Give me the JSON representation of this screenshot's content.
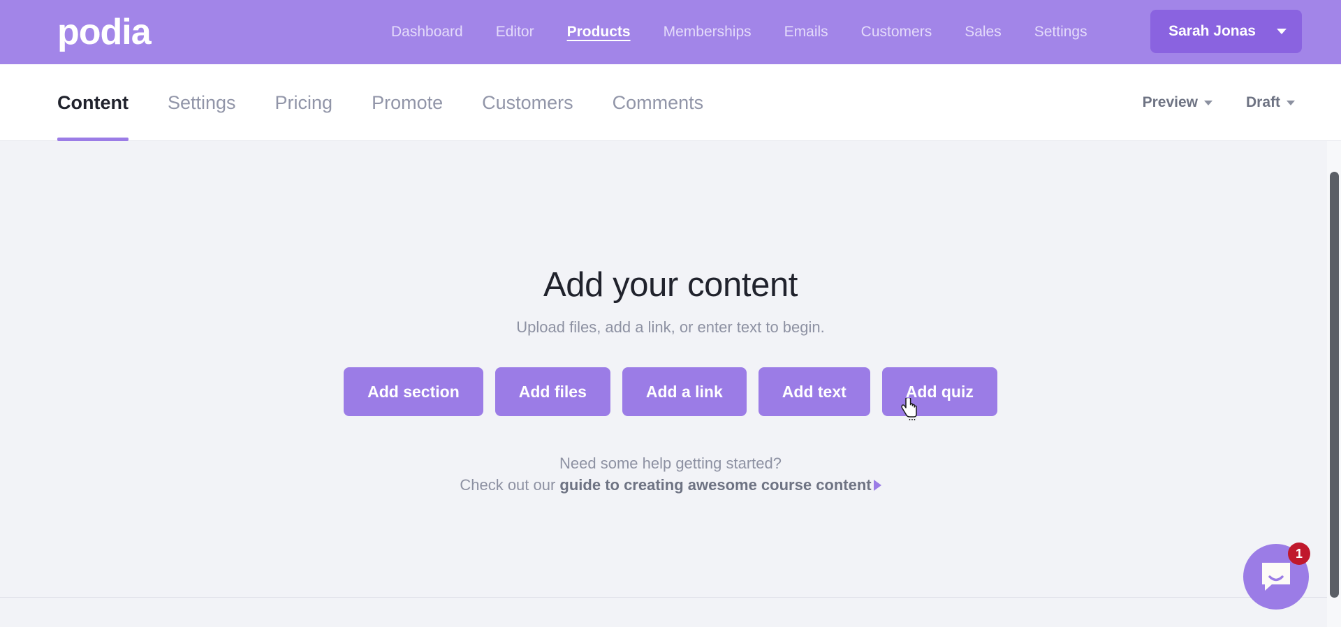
{
  "topnav": {
    "logo_text": "podia",
    "brand_color": "#a285e8",
    "links": [
      {
        "label": "Dashboard",
        "active": false
      },
      {
        "label": "Editor",
        "active": false
      },
      {
        "label": "Products",
        "active": true
      },
      {
        "label": "Memberships",
        "active": false
      },
      {
        "label": "Emails",
        "active": false
      },
      {
        "label": "Customers",
        "active": false
      },
      {
        "label": "Sales",
        "active": false
      },
      {
        "label": "Settings",
        "active": false
      }
    ],
    "account": {
      "name": "Sarah Jonas",
      "caret_icon": "chevron-down-icon",
      "bg_color": "#8a63e0"
    }
  },
  "subnav": {
    "tabs": [
      {
        "label": "Content",
        "active": true
      },
      {
        "label": "Settings",
        "active": false
      },
      {
        "label": "Pricing",
        "active": false
      },
      {
        "label": "Promote",
        "active": false
      },
      {
        "label": "Customers",
        "active": false
      },
      {
        "label": "Comments",
        "active": false
      }
    ],
    "active_underline_color": "#9b7ce6",
    "actions": [
      {
        "label": "Preview",
        "caret_icon": "chevron-down-icon"
      },
      {
        "label": "Draft",
        "caret_icon": "chevron-down-icon"
      }
    ]
  },
  "main": {
    "background_color": "#f2f3f7",
    "title": "Add your content",
    "subtitle": "Upload files, add a link, or enter text to begin.",
    "buttons": [
      {
        "label": "Add section"
      },
      {
        "label": "Add files"
      },
      {
        "label": "Add a link"
      },
      {
        "label": "Add text"
      },
      {
        "label": "Add quiz"
      }
    ],
    "button_color": "#9b7ce6",
    "help": {
      "question": "Need some help getting started?",
      "prefix": "Check out our ",
      "link_text": "guide to creating awesome course content",
      "arrow_icon": "play-triangle-icon"
    }
  },
  "widgets": {
    "intercom": {
      "icon": "chat-bubble-icon",
      "badge_count": "1",
      "badge_color": "#c0182c",
      "bg_color": "#9b7ce6"
    },
    "scrollbar": {
      "orientation": "vertical"
    },
    "cursor": {
      "icon": "pointer-hand-cursor"
    }
  }
}
